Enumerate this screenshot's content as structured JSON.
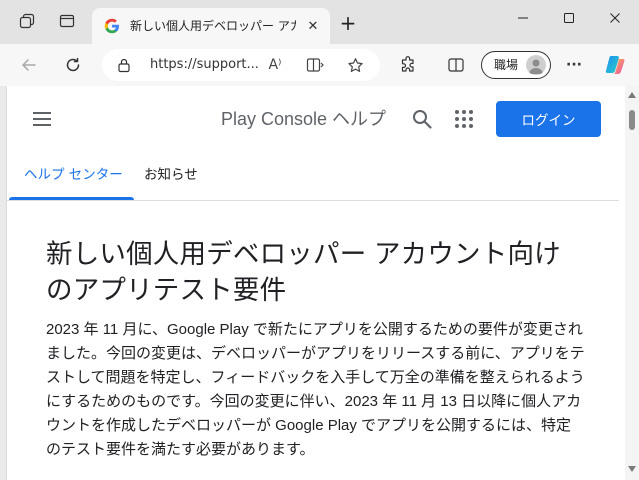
{
  "browser": {
    "tab": {
      "title": "新しい個人用デベロッパー アカウント向",
      "close_glyph": "✕",
      "favicon": "google-g-icon"
    },
    "new_tab_glyph": "+",
    "window_controls": [
      "minimize-icon",
      "maximize-icon",
      "close-icon"
    ],
    "address": {
      "url": "https://support...",
      "read_aloud_glyph": "A⁾"
    },
    "profile": {
      "label": "職場"
    },
    "icons": [
      "back-icon",
      "refresh-icon",
      "lock-icon",
      "read-aloud-icon",
      "immersive-reader-icon",
      "favorite-star-icon",
      "extensions-icon",
      "split-screen-icon",
      "more-icon",
      "copilot-icon"
    ],
    "more_glyph": "···"
  },
  "page": {
    "header": {
      "site_title": "Play Console ヘルプ",
      "login_label": "ログイン"
    },
    "nav": {
      "tabs": [
        {
          "label": "ヘルプ センター",
          "active": true
        },
        {
          "label": "お知らせ",
          "active": false
        }
      ]
    },
    "article": {
      "title": "新しい個人用デベロッパー アカウント向けのアプリテスト要件",
      "body": "2023 年 11 月に、Google Play で新たにアプリを公開するための要件が変更されました。今回の変更は、デベロッパーがアプリをリリースする前に、アプリをテストして問題を特定し、フィードバックを入手して万全の準備を整えられるようにするためのものです。今回の変更に伴い、2023 年 11 月 13 日以降に個人アカウントを作成したデベロッパーが Google Play でアプリを公開するには、特定のテスト要件を満たす必要があります。"
    }
  },
  "colors": {
    "accent": "#1a73e8",
    "text": "#202124",
    "muted": "#5f6368"
  }
}
